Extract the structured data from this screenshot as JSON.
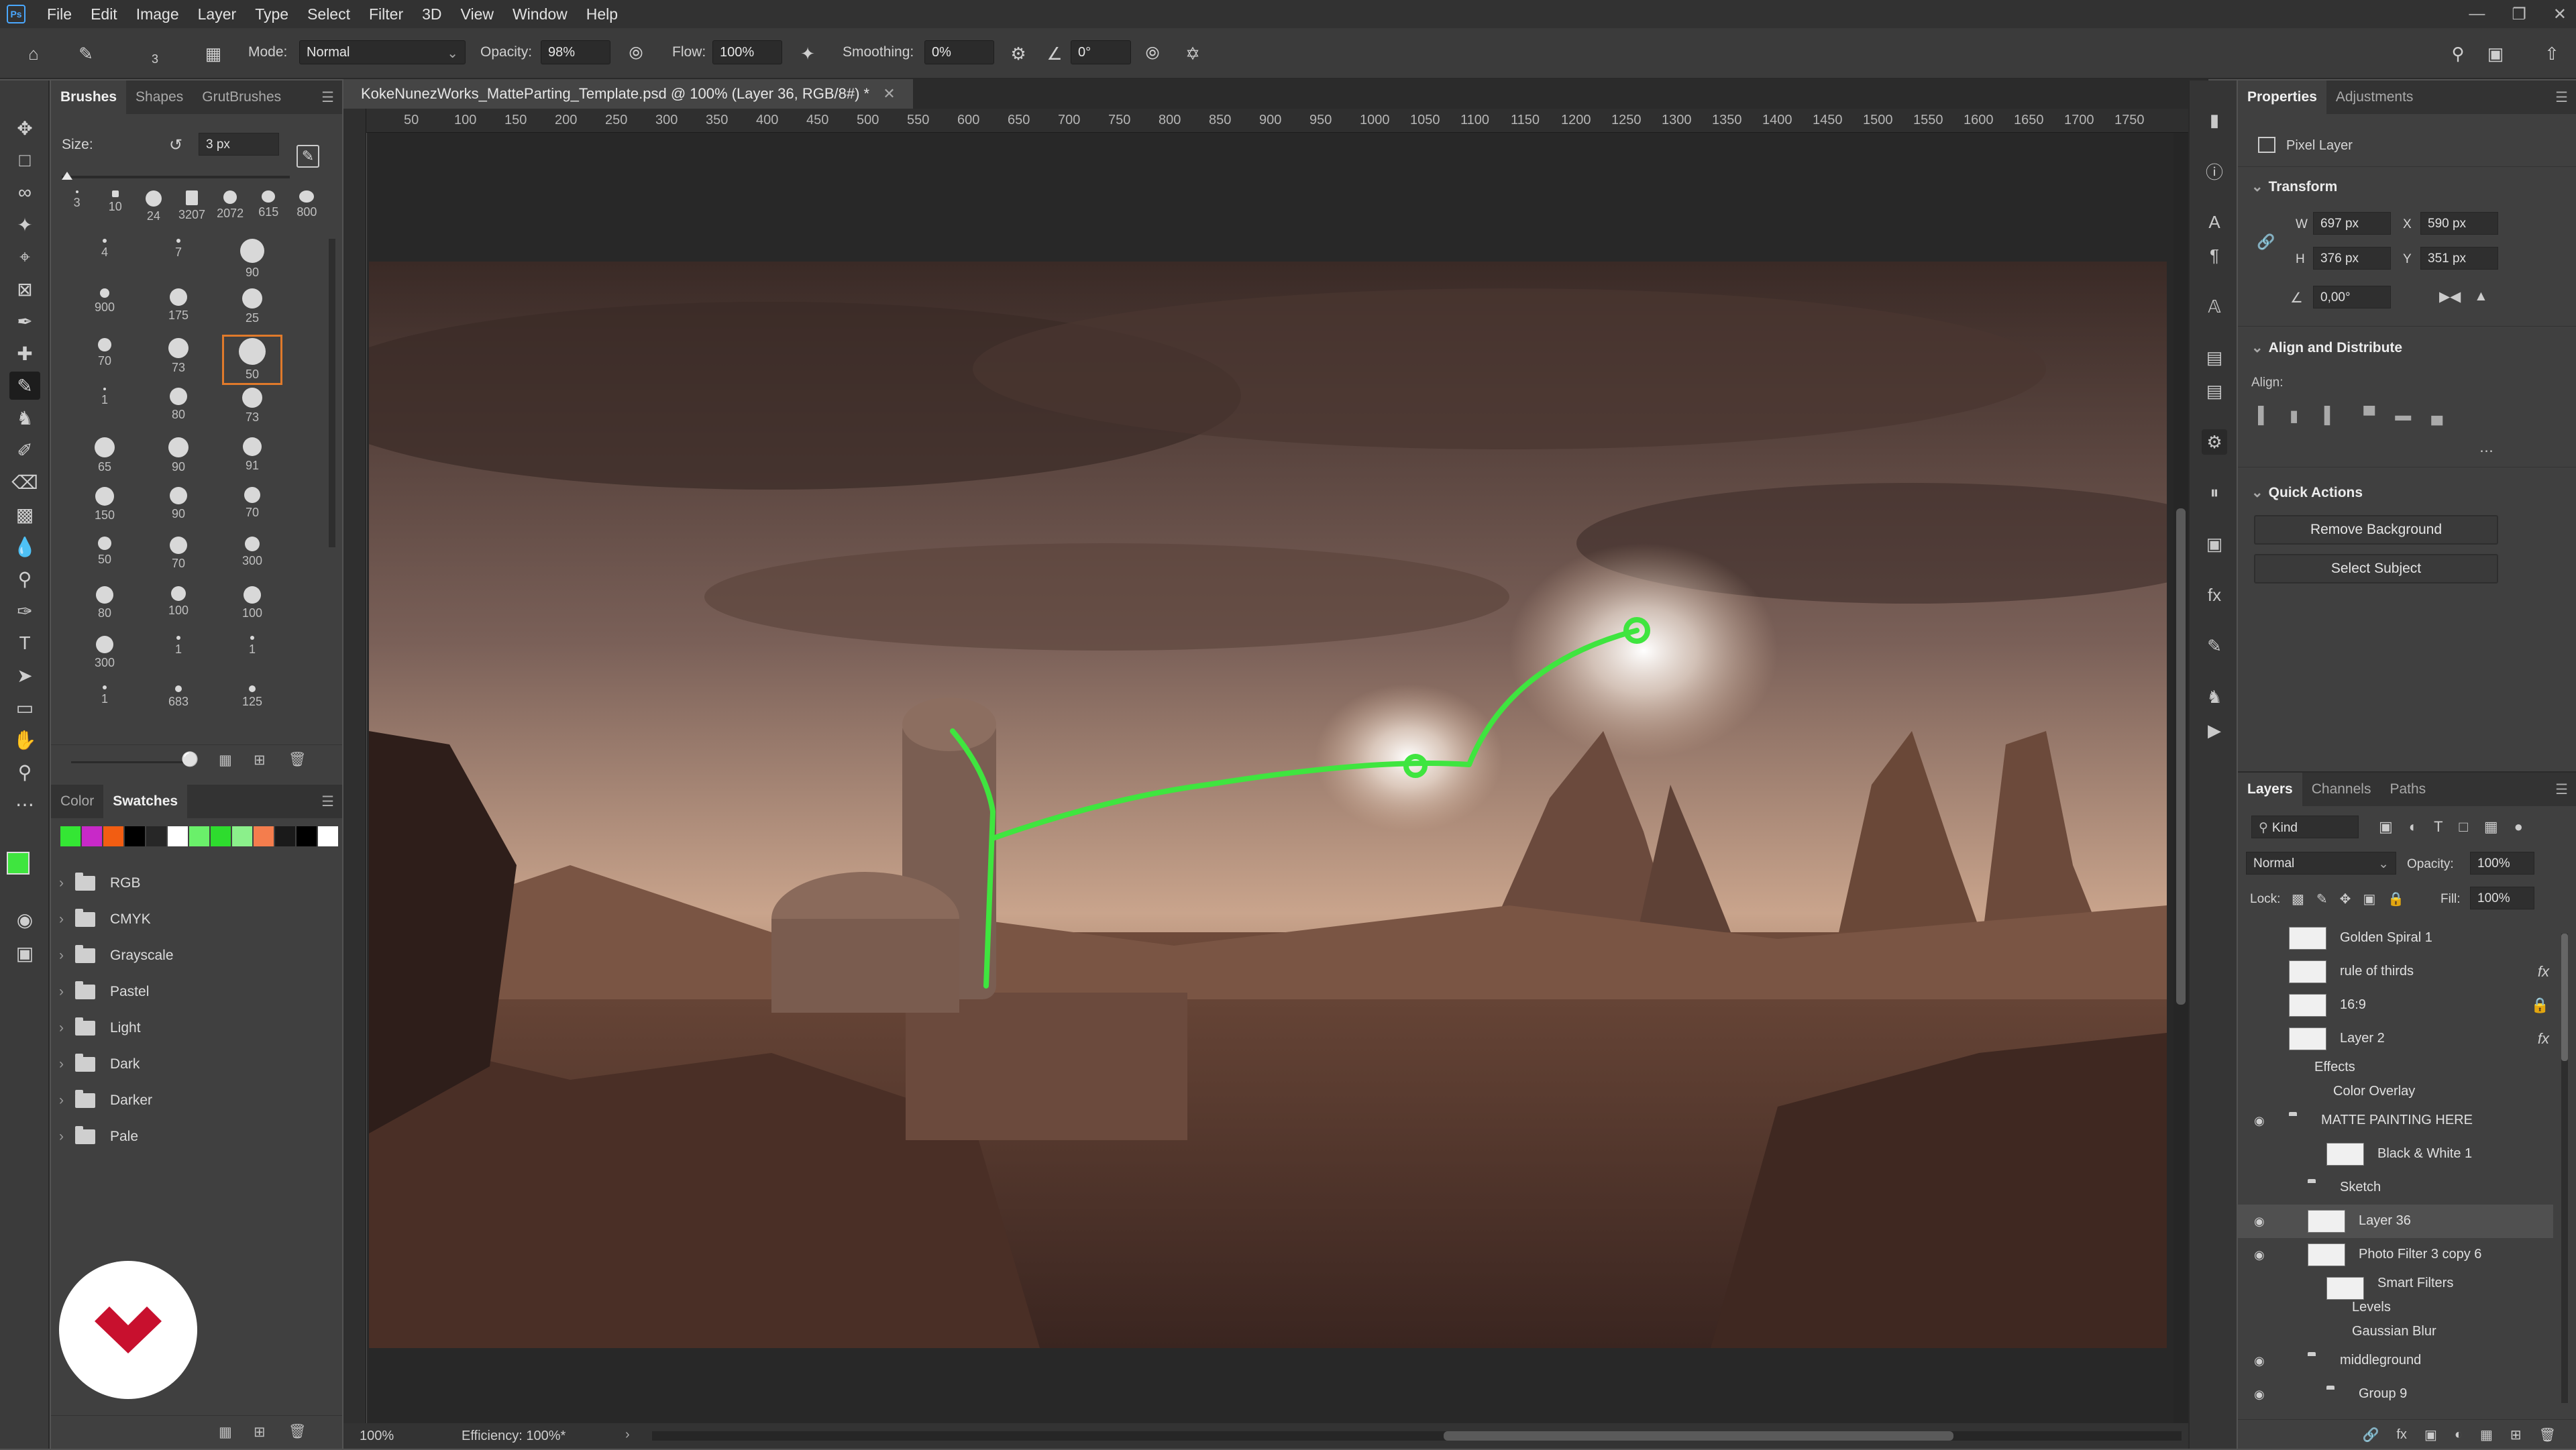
{
  "menu": {
    "items": [
      "File",
      "Edit",
      "Image",
      "Layer",
      "Type",
      "Select",
      "Filter",
      "3D",
      "View",
      "Window",
      "Help"
    ],
    "logo": "Ps"
  },
  "options": {
    "brush_size_small": "3",
    "mode_label": "Mode:",
    "mode_value": "Normal",
    "opacity_label": "Opacity:",
    "opacity_value": "98%",
    "flow_label": "Flow:",
    "flow_value": "100%",
    "smoothing_label": "Smoothing:",
    "smoothing_value": "0%",
    "angle_value": "0°"
  },
  "brushes_panel": {
    "tabs": [
      "Brushes",
      "Shapes",
      "GrutBrushes"
    ],
    "size_label": "Size:",
    "size_value": "3 px",
    "top_row": [
      "3",
      "10",
      "24",
      "3207",
      "2072",
      "615",
      "800"
    ],
    "grid": [
      [
        "4",
        "7",
        "90"
      ],
      [
        "900",
        "175",
        "25"
      ],
      [
        "70",
        "73",
        "50"
      ],
      [
        "1",
        "80",
        "73"
      ],
      [
        "65",
        "90",
        "91"
      ],
      [
        "150",
        "90",
        "70"
      ],
      [
        "50",
        "70",
        "300"
      ],
      [
        "80",
        "100",
        "100"
      ],
      [
        "300",
        "1",
        "1"
      ],
      [
        "1",
        "683",
        "125"
      ]
    ]
  },
  "swatches_panel": {
    "tabs": [
      "Color",
      "Swatches"
    ],
    "swatch_colors": [
      "#34e634",
      "#c829c8",
      "#f25d12",
      "#000000",
      "#272727",
      "#ffffff",
      "#6af06a",
      "#2edc2e",
      "#8bf08b",
      "#f47d4d",
      "#1a1a1a",
      "#000000",
      "#ffffff"
    ],
    "folders": [
      "RGB",
      "CMYK",
      "Grayscale",
      "Pastel",
      "Light",
      "Dark",
      "Darker",
      "Pale"
    ]
  },
  "document": {
    "tab_title": "KokeNunezWorks_MatteParting_Template.psd @ 100% (Layer 36, RGB/8#) *",
    "ruler_h": [
      "50",
      "100",
      "150",
      "200",
      "250",
      "300",
      "350",
      "400",
      "450",
      "500",
      "550",
      "600",
      "650",
      "700",
      "750",
      "800",
      "850",
      "900",
      "950",
      "1000",
      "1050",
      "1100",
      "1150",
      "1200",
      "1250",
      "1300",
      "1350",
      "1400",
      "1450",
      "1500",
      "1550",
      "1600",
      "1650",
      "1700",
      "1750"
    ],
    "zoom": "100%",
    "efficiency": "Efficiency: 100%*"
  },
  "properties": {
    "tabs": [
      "Properties",
      "Adjustments"
    ],
    "pixel_layer": "Pixel Layer",
    "transform_title": "Transform",
    "w_label": "W",
    "w_value": "697 px",
    "x_label": "X",
    "x_value": "590 px",
    "h_label": "H",
    "h_value": "376 px",
    "y_label": "Y",
    "y_value": "351 px",
    "angle_value": "0,00°",
    "align_title": "Align and Distribute",
    "align_label": "Align:",
    "quick_title": "Quick Actions",
    "remove_bg": "Remove Background",
    "select_subject": "Select Subject"
  },
  "layers_panel": {
    "tabs": [
      "Layers",
      "Channels",
      "Paths"
    ],
    "kind": "Kind",
    "blend": "Normal",
    "opacity_label": "Opacity:",
    "opacity_value": "100%",
    "lock_label": "Lock:",
    "fill_label": "Fill:",
    "fill_value": "100%",
    "layers": [
      "Golden Spiral 1",
      "rule of thirds",
      "16:9",
      "Layer 2",
      "Effects",
      "Color Overlay",
      "MATTE PAINTING HERE",
      "Black & White 1",
      "Sketch",
      "Layer 36",
      "Photo Filter 3 copy 6",
      "Smart Filters",
      "Levels",
      "Gaussian Blur",
      "middleground",
      "Group 9"
    ]
  },
  "colors": {
    "accent_green": "#3fe53f",
    "selection_orange": "#e07a2b",
    "logo_red": "#c8102e"
  }
}
